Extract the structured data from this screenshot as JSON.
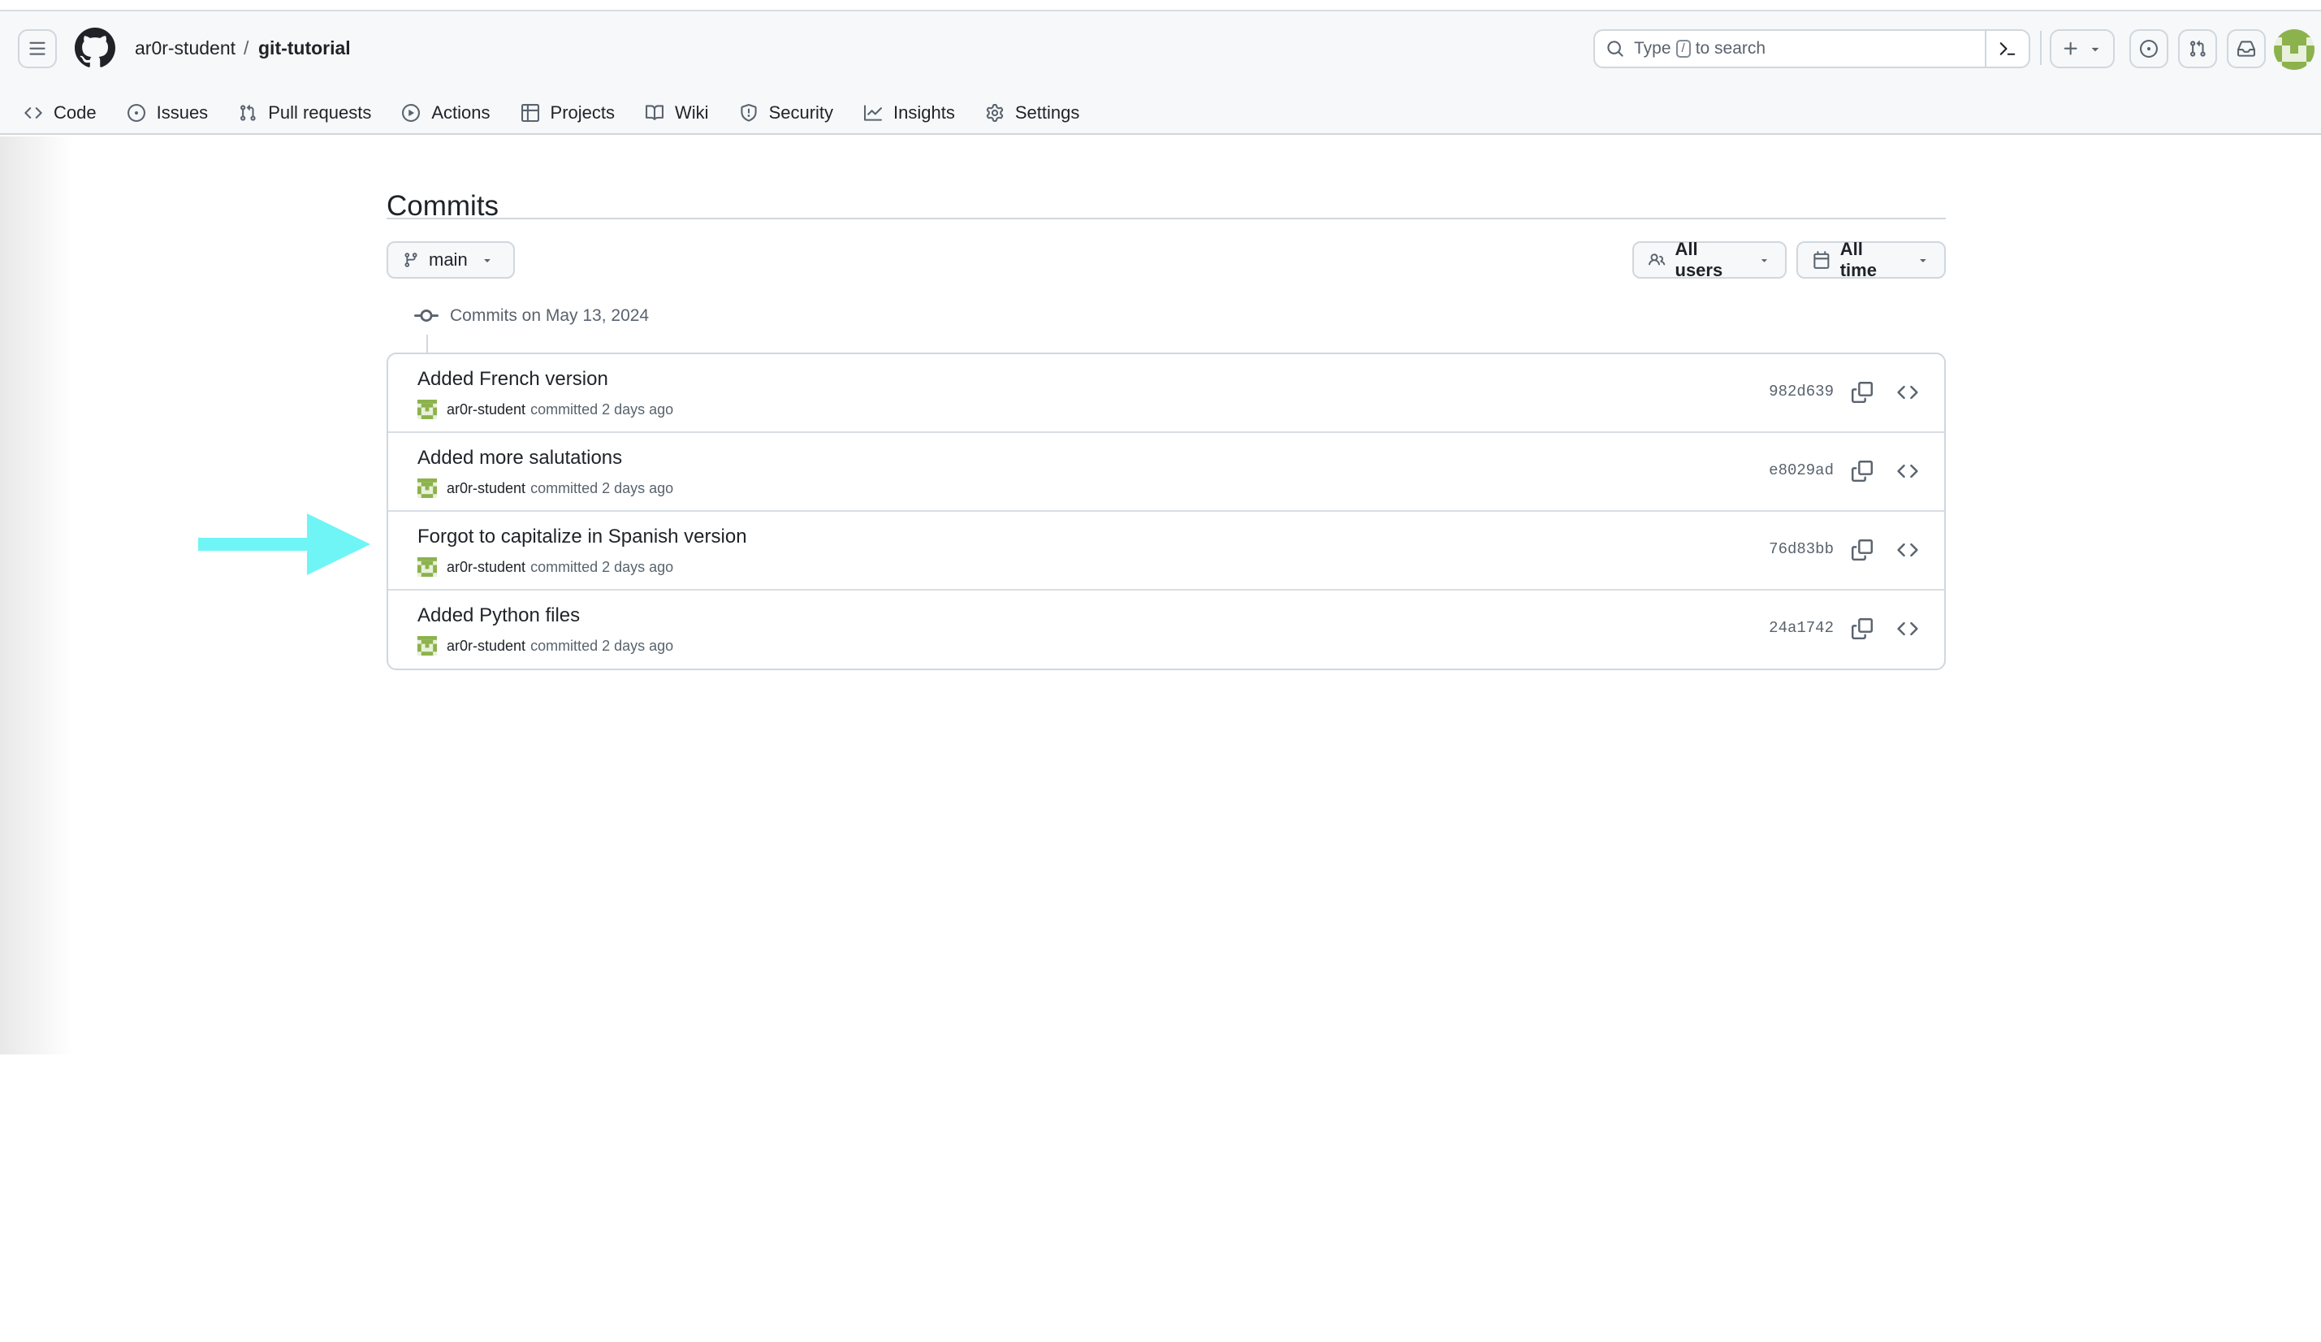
{
  "header": {
    "owner": "ar0r-student",
    "separator": "/",
    "repo": "git-tutorial",
    "search": {
      "before_key": "Type",
      "key": "/",
      "after_key": "to search"
    }
  },
  "nav": {
    "items": [
      {
        "label": "Code",
        "icon": "code-icon"
      },
      {
        "label": "Issues",
        "icon": "issue-opened-icon"
      },
      {
        "label": "Pull requests",
        "icon": "git-pull-request-icon"
      },
      {
        "label": "Actions",
        "icon": "play-icon"
      },
      {
        "label": "Projects",
        "icon": "table-icon"
      },
      {
        "label": "Wiki",
        "icon": "book-icon"
      },
      {
        "label": "Security",
        "icon": "shield-icon"
      },
      {
        "label": "Insights",
        "icon": "graph-icon"
      },
      {
        "label": "Settings",
        "icon": "gear-icon"
      }
    ]
  },
  "page": {
    "title": "Commits"
  },
  "filters": {
    "branch": "main",
    "users": "All users",
    "time": "All time"
  },
  "commit_group": {
    "heading": "Commits on May 13, 2024"
  },
  "commits": [
    {
      "message": "Added French version",
      "author": "ar0r-student",
      "action": "committed 2 days ago",
      "sha": "982d639"
    },
    {
      "message": "Added more salutations",
      "author": "ar0r-student",
      "action": "committed 2 days ago",
      "sha": "e8029ad"
    },
    {
      "message": "Forgot to capitalize in Spanish version",
      "author": "ar0r-student",
      "action": "committed 2 days ago",
      "sha": "76d83bb"
    },
    {
      "message": "Added Python files",
      "author": "ar0r-student",
      "action": "committed 2 days ago",
      "sha": "24a1742"
    }
  ],
  "annotation": {
    "arrow_color": "#6ff5f5",
    "points_to_commit": "76d83bb"
  },
  "colors": {
    "avatar": "#8cb24d",
    "text": "#1f2328",
    "muted": "#59636e",
    "border": "#d0d7de"
  }
}
